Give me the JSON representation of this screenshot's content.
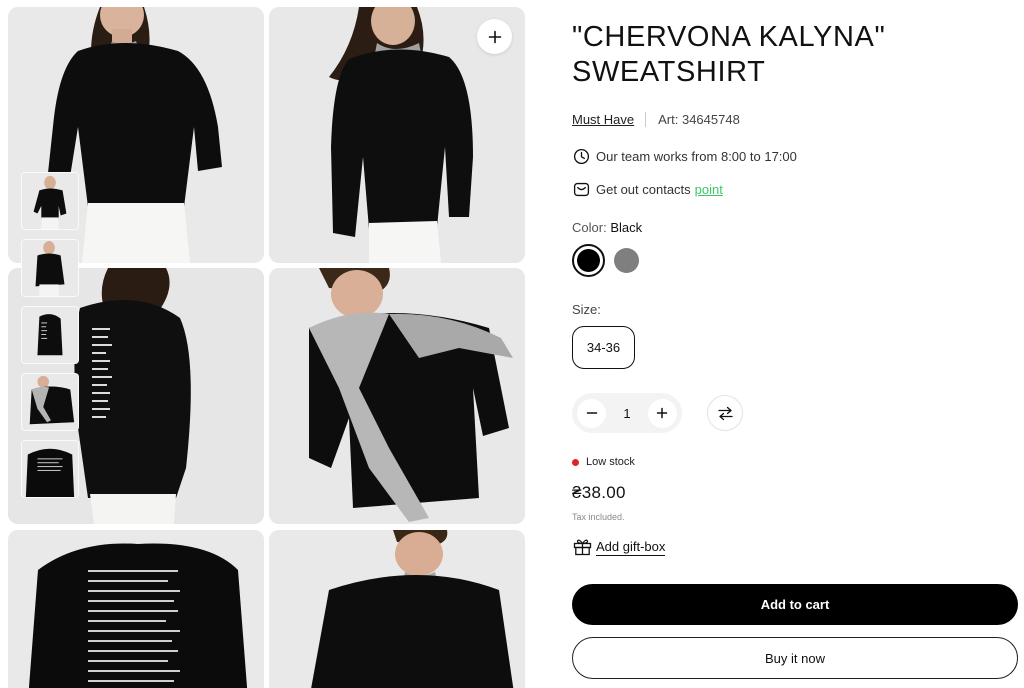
{
  "product": {
    "title_line1": "\"CHERVONA KALYNA\"",
    "title_line2": "SWEATSHIRT",
    "brand": "Must Have",
    "article": "Art: 34645748"
  },
  "info": {
    "hours": "Our team works from 8:00 to 17:00",
    "contacts_text": "Get out contacts",
    "contacts_link": "point"
  },
  "color": {
    "label": "Color:",
    "selected": "Black",
    "options": [
      {
        "name": "Black",
        "hex": "#000000"
      },
      {
        "name": "Grey",
        "hex": "#7f7f7f"
      }
    ]
  },
  "size": {
    "label": "Size:",
    "selected": "34-36"
  },
  "quantity": {
    "value": "1"
  },
  "stock": {
    "label": "Low stock",
    "color": "#e02424"
  },
  "price": {
    "value": "₴38.00",
    "tax_note": "Tax included."
  },
  "gift": {
    "label": "Add gift-box"
  },
  "actions": {
    "add_to_cart": "Add to cart",
    "buy_now": "Buy it now"
  },
  "gallery": {
    "photos": [
      {
        "alt": "Woman in black sweatshirt, front view"
      },
      {
        "alt": "Woman in black sweatshirt, three-quarter view"
      },
      {
        "alt": "Woman in black sweatshirt, back view with print"
      },
      {
        "alt": "Man in black sweatshirt with grey sweater on shoulders"
      },
      {
        "alt": "Back of sweatshirt with text print"
      },
      {
        "alt": "Man in black sweatshirt, front view"
      }
    ],
    "thumbnail_count": 5
  },
  "icons": {
    "zoom": "plus-icon",
    "clock": "clock-icon",
    "contacts": "message-icon",
    "minus": "minus-icon",
    "plus": "plus-icon",
    "compare": "compare-arrows-icon",
    "gift": "gift-icon"
  }
}
